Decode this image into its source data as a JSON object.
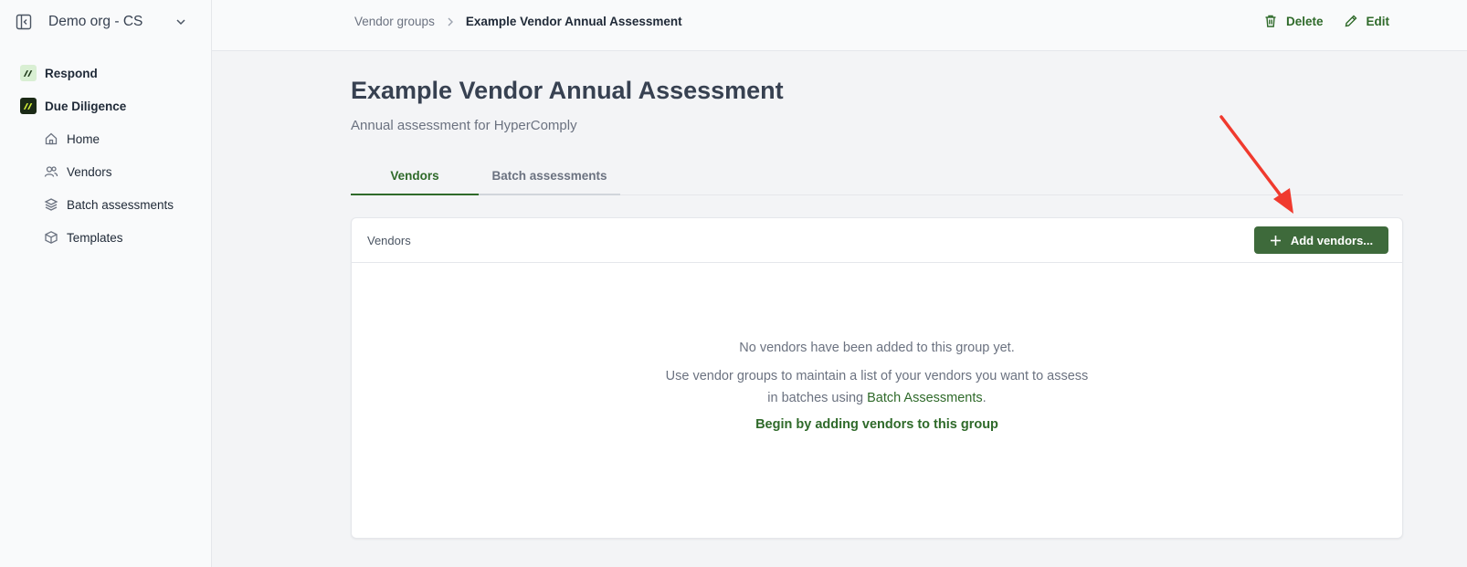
{
  "sidebar": {
    "org_name": "Demo org - CS",
    "items": [
      {
        "label": "Respond",
        "icon": "respond-logo-icon"
      },
      {
        "label": "Due Diligence",
        "icon": "due-diligence-logo-icon"
      }
    ],
    "sub_items": [
      {
        "label": "Home",
        "icon": "home-icon"
      },
      {
        "label": "Vendors",
        "icon": "users-icon"
      },
      {
        "label": "Batch assessments",
        "icon": "layers-icon"
      },
      {
        "label": "Templates",
        "icon": "box-icon"
      }
    ]
  },
  "header": {
    "breadcrumb": {
      "parent": "Vendor groups",
      "current": "Example Vendor Annual Assessment"
    },
    "actions": {
      "delete_label": "Delete",
      "edit_label": "Edit"
    }
  },
  "main": {
    "title": "Example Vendor Annual Assessment",
    "subtitle": "Annual assessment for HyperComply",
    "tabs": [
      {
        "label": "Vendors",
        "active": true
      },
      {
        "label": "Batch assessments",
        "active": false
      }
    ],
    "card": {
      "title": "Vendors",
      "add_button_label": "Add vendors...",
      "empty_message": "No vendors have been added to this group yet.",
      "help_text_prefix": "Use vendor groups to maintain a list of your vendors you want to assess in batches using ",
      "help_link": "Batch Assessments",
      "help_text_suffix": ".",
      "cta": "Begin by adding vendors to this group"
    }
  },
  "colors": {
    "accent": "#2f6a2a",
    "button_bg": "#3e6a3b",
    "annotation_arrow": "#f03a2e"
  }
}
